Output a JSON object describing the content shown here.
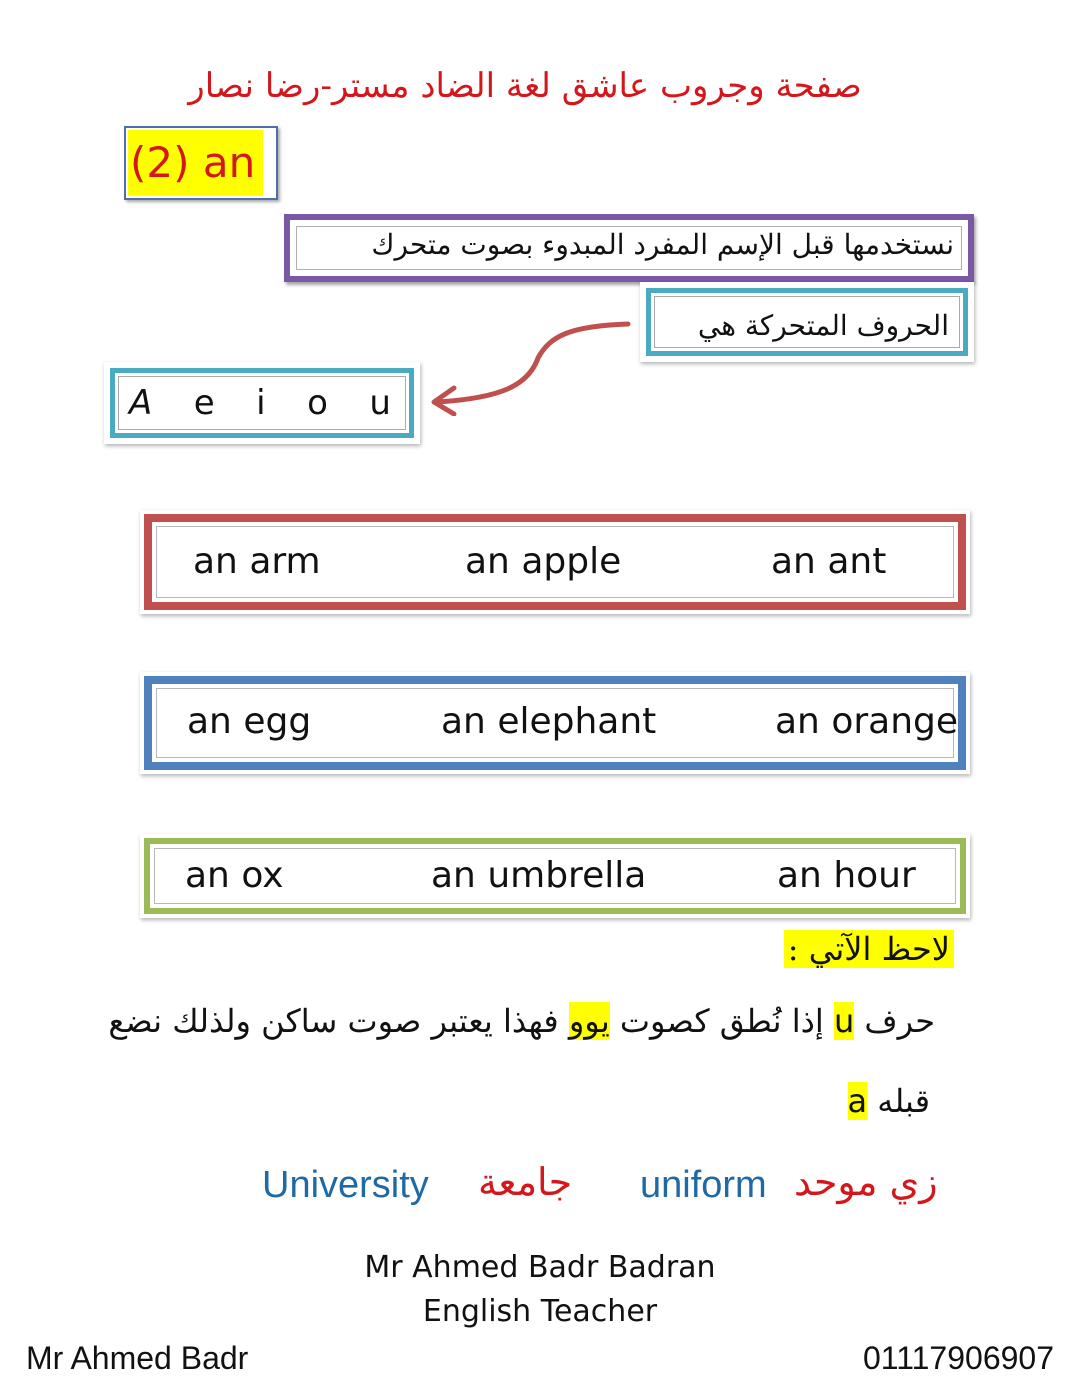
{
  "header": {
    "title": "صفحة وجروب عاشق لغة الضاد مستر-رضا نصار",
    "section_label": "(2) an"
  },
  "rule": {
    "usage_text": "نستخدمها قبل الإسم المفرد المبدوء بصوت متحرك",
    "vowels_label": "الحروف المتحركة هي",
    "vowels": [
      "A",
      "e",
      "i",
      "o",
      "u"
    ]
  },
  "example_rows": [
    {
      "color": "#c0504d",
      "words": [
        "an arm",
        "an apple",
        "an ant"
      ]
    },
    {
      "color": "#4f81bd",
      "words": [
        "an egg",
        "an elephant",
        "an orange"
      ]
    },
    {
      "color": "#9bbb59",
      "words": [
        "an ox",
        "an umbrella",
        "an hour"
      ]
    }
  ],
  "note": {
    "heading": "لاحظ الآتي :",
    "line1_part1": "حرف",
    "line1_letter": "u",
    "line1_part2": "إذا نُطق كصوت",
    "line1_sound": "يوو",
    "line1_part3": "فهذا يعتبر صوت ساكن ولذلك نضع",
    "line2_part1": "قبله",
    "line2_letter": "a"
  },
  "examples": {
    "word1_en": "University",
    "word1_ar": "جامعة",
    "word2_en": "uniform",
    "word2_ar": "زي موحد"
  },
  "signature": {
    "name": "Mr Ahmed Badr Badran",
    "role": "English Teacher"
  },
  "footer": {
    "left": "Mr  Ahmed  Badr",
    "right": "01117906907"
  },
  "colors": {
    "title_red": "#d4171c",
    "highlight_yellow": "#ffff00",
    "purple": "#7b58a6",
    "teal": "#4aaac0",
    "english_blue": "#1f6aa5"
  }
}
